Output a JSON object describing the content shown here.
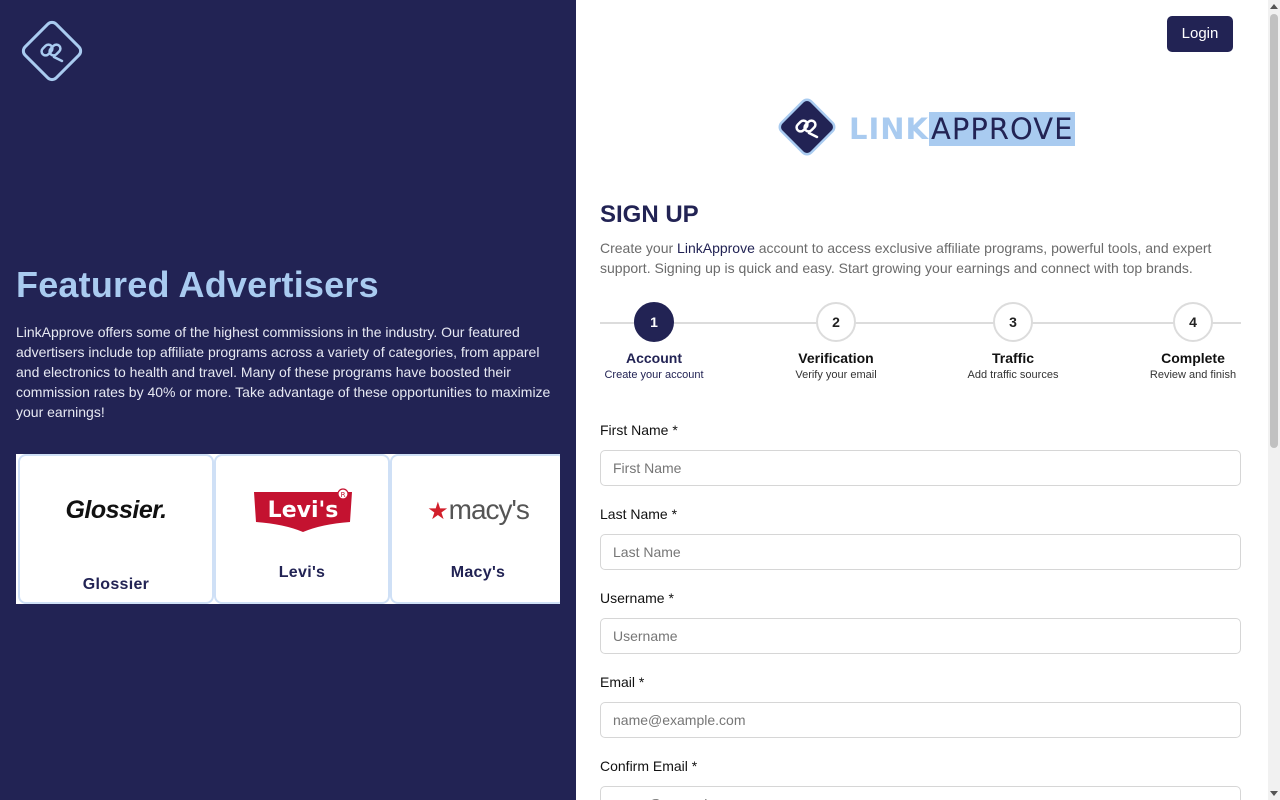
{
  "left_panel": {
    "logo_icon": "link-approve-logo-icon",
    "featured_title": "Featured Advertisers",
    "featured_description": "LinkApprove offers some of the highest commissions in the industry. Our featured advertisers include top affiliate programs across a variety of categories, from apparel and electronics to health and travel. Many of these programs have boosted their commission rates by 40% or more. Take advantage of these opportunities to maximize your earnings!",
    "advertisers": [
      {
        "name": "Glossier",
        "logo_text": "Glossier."
      },
      {
        "name": "Levi's",
        "logo_text": "Levi's"
      },
      {
        "name": "Macy's",
        "logo_text": "macy's"
      }
    ]
  },
  "header": {
    "login_label": "Login"
  },
  "brand": {
    "word_link": "LINK",
    "word_approve": "APPROVE"
  },
  "signup": {
    "title": "SIGN UP",
    "desc_prefix": "Create your ",
    "desc_highlight": "LinkApprove",
    "desc_suffix": " account to access exclusive affiliate programs, powerful tools, and expert support. Signing up is quick and easy. Start growing your earnings and connect with top brands."
  },
  "steps": [
    {
      "number": "1",
      "title": "Account",
      "subtitle": "Create your account",
      "active": true
    },
    {
      "number": "2",
      "title": "Verification",
      "subtitle": "Verify your email",
      "active": false
    },
    {
      "number": "3",
      "title": "Traffic",
      "subtitle": "Add traffic sources",
      "active": false
    },
    {
      "number": "4",
      "title": "Complete",
      "subtitle": "Review and finish",
      "active": false
    }
  ],
  "form": {
    "first_name": {
      "label": "First Name *",
      "placeholder": "First Name",
      "value": ""
    },
    "last_name": {
      "label": "Last Name *",
      "placeholder": "Last Name",
      "value": ""
    },
    "username": {
      "label": "Username *",
      "placeholder": "Username",
      "value": ""
    },
    "email": {
      "label": "Email *",
      "placeholder": "name@example.com",
      "value": ""
    },
    "confirm_email": {
      "label": "Confirm Email *",
      "placeholder": "name@example.com",
      "value": ""
    }
  },
  "colors": {
    "navy": "#222354",
    "light_blue": "#a9cbf0",
    "levis_red": "#c41230",
    "macys_red": "#d21f2b"
  }
}
